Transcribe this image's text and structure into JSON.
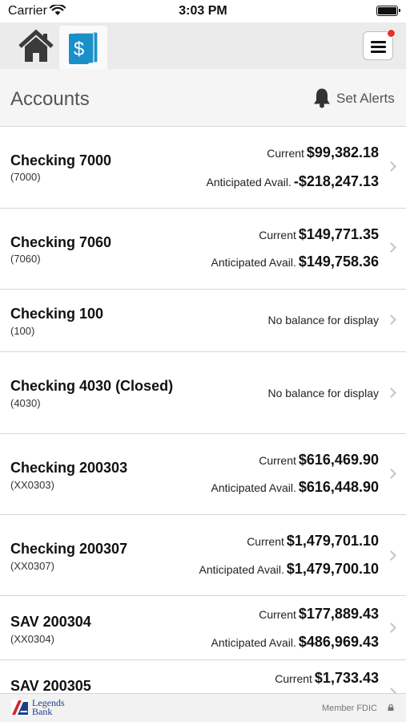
{
  "status_bar": {
    "carrier": "Carrier",
    "time": "3:03 PM"
  },
  "tabs": [
    {
      "name": "home",
      "icon": "home-icon"
    },
    {
      "name": "accounts",
      "icon": "dollar-cards-icon",
      "selected": true,
      "accent": "#1a90c8"
    }
  ],
  "menu": {
    "icon": "hamburger-menu-icon",
    "has_notification": true,
    "badge_color": "#e4312b"
  },
  "header": {
    "title": "Accounts",
    "alerts_label": "Set Alerts"
  },
  "accounts": [
    {
      "name": "Checking 7000",
      "number": "(7000)",
      "current_label": "Current",
      "current": "$99,382.18",
      "avail_label": "Anticipated Avail.",
      "avail": "-$218,247.13"
    },
    {
      "name": "Checking 7060",
      "number": "(7060)",
      "current_label": "Current",
      "current": "$149,771.35",
      "avail_label": "Anticipated Avail.",
      "avail": "$149,758.36"
    },
    {
      "name": "Checking 100",
      "number": "(100)",
      "no_balance": "No balance for display"
    },
    {
      "name": "Checking 4030 (Closed)",
      "number": "(4030)",
      "no_balance": "No balance for display"
    },
    {
      "name": "Checking 200303",
      "number": "(XX0303)",
      "current_label": "Current",
      "current": "$616,469.90",
      "avail_label": "Anticipated Avail.",
      "avail": "$616,448.90"
    },
    {
      "name": "Checking 200307",
      "number": "(XX0307)",
      "current_label": "Current",
      "current": "$1,479,701.10",
      "avail_label": "Anticipated Avail.",
      "avail": "$1,479,700.10"
    },
    {
      "name": "SAV 200304",
      "number": "(XX0304)",
      "current_label": "Current",
      "current": "$177,889.43",
      "avail_label": "Anticipated Avail.",
      "avail": "$486,969.43"
    },
    {
      "name": "SAV 200305",
      "current_label": "Current",
      "current": "$1,733.43"
    }
  ],
  "footer": {
    "brand_line1": "Legends",
    "brand_line2": "Bank",
    "fdic": "Member FDIC"
  },
  "colors": {
    "brand_blue": "#1b3f8c",
    "brand_red": "#d62631",
    "accent": "#1a90c8"
  }
}
